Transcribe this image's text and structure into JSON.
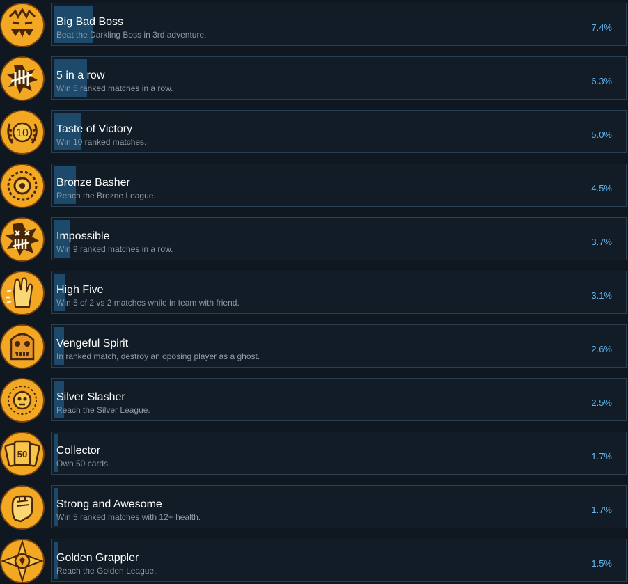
{
  "achievements": [
    {
      "title": "Big Bad Boss",
      "description": "Beat the Darkling Boss in 3rd adventure.",
      "percent_label": "7.4%",
      "percent": 7.4,
      "icon": "boss-face-icon"
    },
    {
      "title": "5 in a row",
      "description": "Win 5 ranked matches in a row.",
      "percent_label": "6.3%",
      "percent": 6.3,
      "icon": "tally-marks-icon"
    },
    {
      "title": "Taste of Victory",
      "description": "Win 10 ranked matches.",
      "percent_label": "5.0%",
      "percent": 5.0,
      "icon": "laurel-ten-icon",
      "icon_text": "10"
    },
    {
      "title": "Bronze Basher",
      "description": "Reach the Brozne League.",
      "percent_label": "4.5%",
      "percent": 4.5,
      "icon": "bronze-emblem-icon"
    },
    {
      "title": "Impossible",
      "description": "Win 9 ranked matches in a row.",
      "percent_label": "3.7%",
      "percent": 3.7,
      "icon": "dead-face-tally-icon"
    },
    {
      "title": "High Five",
      "description": "Win 5 of 2 vs 2 matches while in team with friend.",
      "percent_label": "3.1%",
      "percent": 3.1,
      "icon": "high-five-hand-icon"
    },
    {
      "title": "Vengeful Spirit",
      "description": "In ranked match, destroy an oposing player as a ghost.",
      "percent_label": "2.6%",
      "percent": 2.6,
      "icon": "ghost-face-icon"
    },
    {
      "title": "Silver Slasher",
      "description": "Reach the Silver League.",
      "percent_label": "2.5%",
      "percent": 2.5,
      "icon": "skull-sun-emblem-icon"
    },
    {
      "title": "Collector",
      "description": "Own 50 cards.",
      "percent_label": "1.7%",
      "percent": 1.7,
      "icon": "cards-fifty-icon",
      "icon_text": "50"
    },
    {
      "title": "Strong and Awesome",
      "description": "Win 5 ranked matches with 12+ health.",
      "percent_label": "1.7%",
      "percent": 1.7,
      "icon": "fist-icon"
    },
    {
      "title": "Golden Grappler",
      "description": "Reach the Golden League.",
      "percent_label": "1.5%",
      "percent": 1.5,
      "icon": "gold-star-emblem-icon"
    }
  ],
  "colors": {
    "background": "#0f1720",
    "panel": "#111c27",
    "panel_border": "#2a3f52",
    "progress_bar": "#1d4a6b",
    "title": "#ffffff",
    "description": "#8e9aa6",
    "percent": "#62b6f0",
    "icon_gold": "#f2a823",
    "icon_dark": "#4a2608"
  }
}
